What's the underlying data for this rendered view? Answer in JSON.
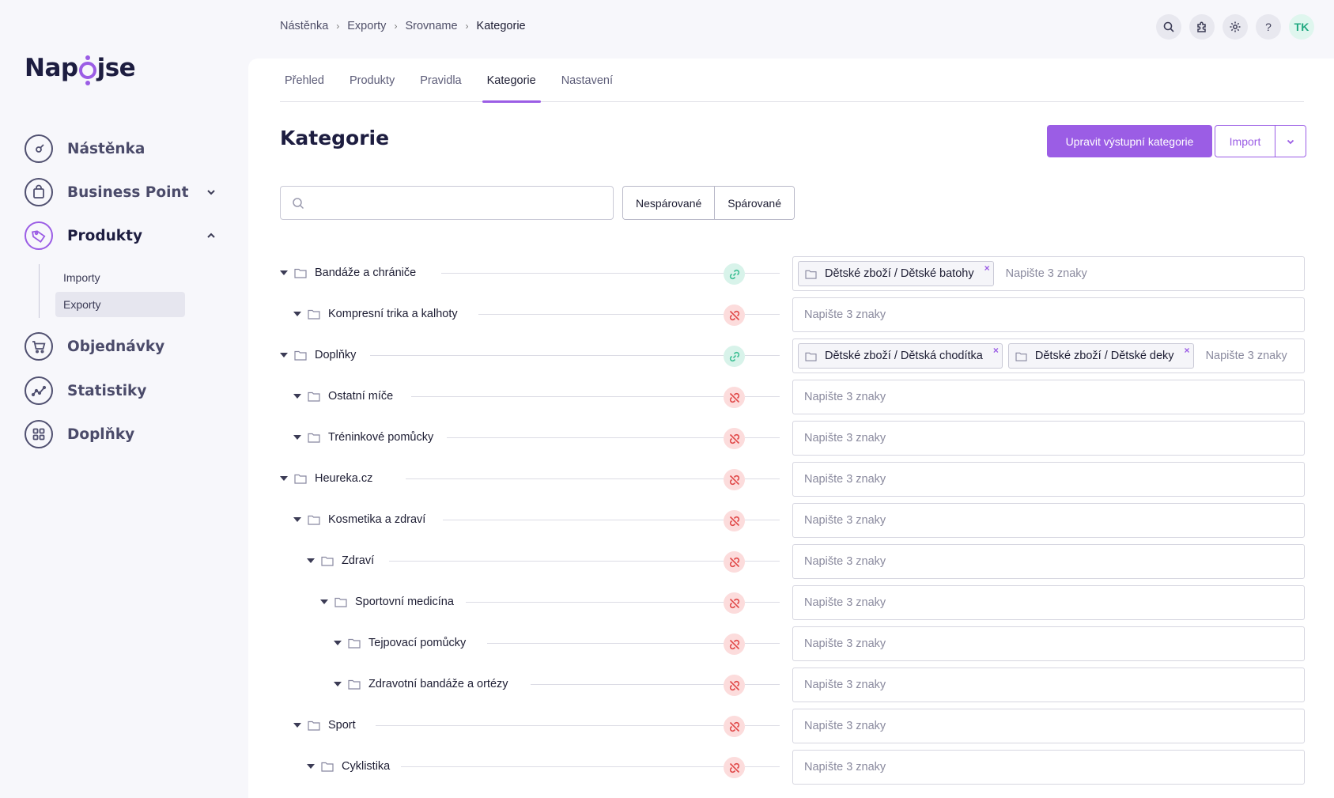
{
  "app": {
    "logo_text_a": "Nap",
    "logo_text_b": "jse"
  },
  "sidebar": {
    "items": [
      {
        "label": "Nástěnka"
      },
      {
        "label": "Business Point"
      },
      {
        "label": "Produkty"
      },
      {
        "label": "Objednávky"
      },
      {
        "label": "Statistiky"
      },
      {
        "label": "Doplňky"
      }
    ],
    "subitems": [
      {
        "label": "Importy"
      },
      {
        "label": "Exporty"
      }
    ]
  },
  "breadcrumb": [
    "Nástěnka",
    "Exporty",
    "Srovname",
    "Kategorie"
  ],
  "user": {
    "initials": "TK"
  },
  "tabs": [
    "Přehled",
    "Produkty",
    "Pravidla",
    "Kategorie",
    "Nastavení"
  ],
  "page": {
    "title": "Kategorie",
    "primary_button": "Upravit výstupní kategorie",
    "import_button": "Import",
    "filter_unpaired": "Nespárované",
    "filter_paired": "Spárované",
    "search_placeholder": ""
  },
  "mapping_placeholder": "Napište 3 znaky",
  "colors": {
    "accent": "#9b5de5",
    "linked": "#3dbf94",
    "unlinked": "#e04848"
  },
  "rows": [
    {
      "name": "Bandáže a chrániče",
      "status": "linked",
      "chips": [
        "Dětské zboží / Dětské batohy"
      ]
    },
    {
      "name": "Kompresní trika a kalhoty",
      "status": "unlinked",
      "chips": []
    },
    {
      "name": "Doplňky",
      "status": "linked",
      "chips": [
        "Dětské zboží / Dětská chodítka",
        "Dětské zboží / Dětské deky"
      ]
    },
    {
      "name": "Ostatní míče",
      "status": "unlinked",
      "chips": []
    },
    {
      "name": "Tréninkové pomůcky",
      "status": "unlinked",
      "chips": []
    },
    {
      "name": "Heureka.cz",
      "status": "unlinked",
      "chips": []
    },
    {
      "name": "Kosmetika a zdraví",
      "status": "unlinked",
      "chips": []
    },
    {
      "name": "Zdraví",
      "status": "unlinked",
      "chips": []
    },
    {
      "name": "Sportovní medicína",
      "status": "unlinked",
      "chips": []
    },
    {
      "name": "Tejpovací pomůcky",
      "status": "unlinked",
      "chips": []
    },
    {
      "name": "Zdravotní bandáže a ortézy",
      "status": "unlinked",
      "chips": []
    },
    {
      "name": "Sport",
      "status": "unlinked",
      "chips": []
    },
    {
      "name": "Cyklistika",
      "status": "unlinked",
      "chips": []
    }
  ]
}
